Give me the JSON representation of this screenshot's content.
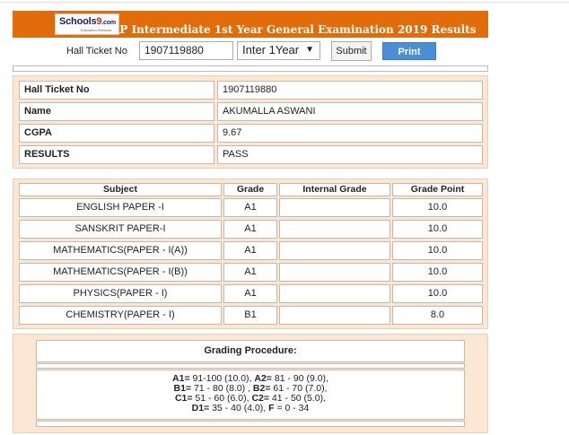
{
  "header": {
    "logo_main": "Schools",
    "logo_accent": "9",
    "logo_suffix": ".com",
    "logo_sub": "Education Services",
    "title": "AP Intermediate 1st Year General Examination 2019 Results",
    "brand_color": "#e36c0a"
  },
  "search": {
    "hall_ticket_label": "Hall Ticket No",
    "hall_ticket_value": "1907119880",
    "year_selected": "Inter 1Year",
    "submit_label": "Submit",
    "print_label": "Print"
  },
  "student": {
    "rows": [
      {
        "key": "Hall Ticket No",
        "value": "1907119880"
      },
      {
        "key": "Name",
        "value": "AKUMALLA ASWANI"
      },
      {
        "key": "CGPA",
        "value": "9.67"
      },
      {
        "key": "RESULTS",
        "value": "PASS"
      }
    ]
  },
  "marks": {
    "columns": [
      "Subject",
      "Grade",
      "Internal Grade",
      "Grade Point"
    ],
    "rows": [
      {
        "subject": "ENGLISH PAPER -I",
        "grade": "A1",
        "internal": "",
        "point": "10.0"
      },
      {
        "subject": "SANSKRIT PAPER-I",
        "grade": "A1",
        "internal": "",
        "point": "10.0"
      },
      {
        "subject": "MATHEMATICS(PAPER - I(A))",
        "grade": "A1",
        "internal": "",
        "point": "10.0"
      },
      {
        "subject": "MATHEMATICS(PAPER - I(B))",
        "grade": "A1",
        "internal": "",
        "point": "10.0"
      },
      {
        "subject": "PHYSICS(PAPER - I)",
        "grade": "A1",
        "internal": "",
        "point": "10.0"
      },
      {
        "subject": "CHEMISTRY(PAPER - I)",
        "grade": "B1",
        "internal": "",
        "point": "8.0"
      }
    ]
  },
  "grading": {
    "title": "Grading Procedure:",
    "lines": [
      [
        {
          "k": "A1=",
          "v": " 91-100 (10.0), "
        },
        {
          "k": "A2=",
          "v": " 81 - 90 (9.0),"
        }
      ],
      [
        {
          "k": "B1=",
          "v": " 71 - 80 (8.0) , "
        },
        {
          "k": "B2=",
          "v": " 61 - 70 (7.0),"
        }
      ],
      [
        {
          "k": "C1=",
          "v": " 51 - 60 (6.0), "
        },
        {
          "k": "C2=",
          "v": " 41 - 50 (5.0),"
        }
      ],
      [
        {
          "k": "D1=",
          "v": " 35 - 40 (4.0), "
        },
        {
          "k": "F",
          "v": " = 0 - 34"
        }
      ]
    ]
  }
}
